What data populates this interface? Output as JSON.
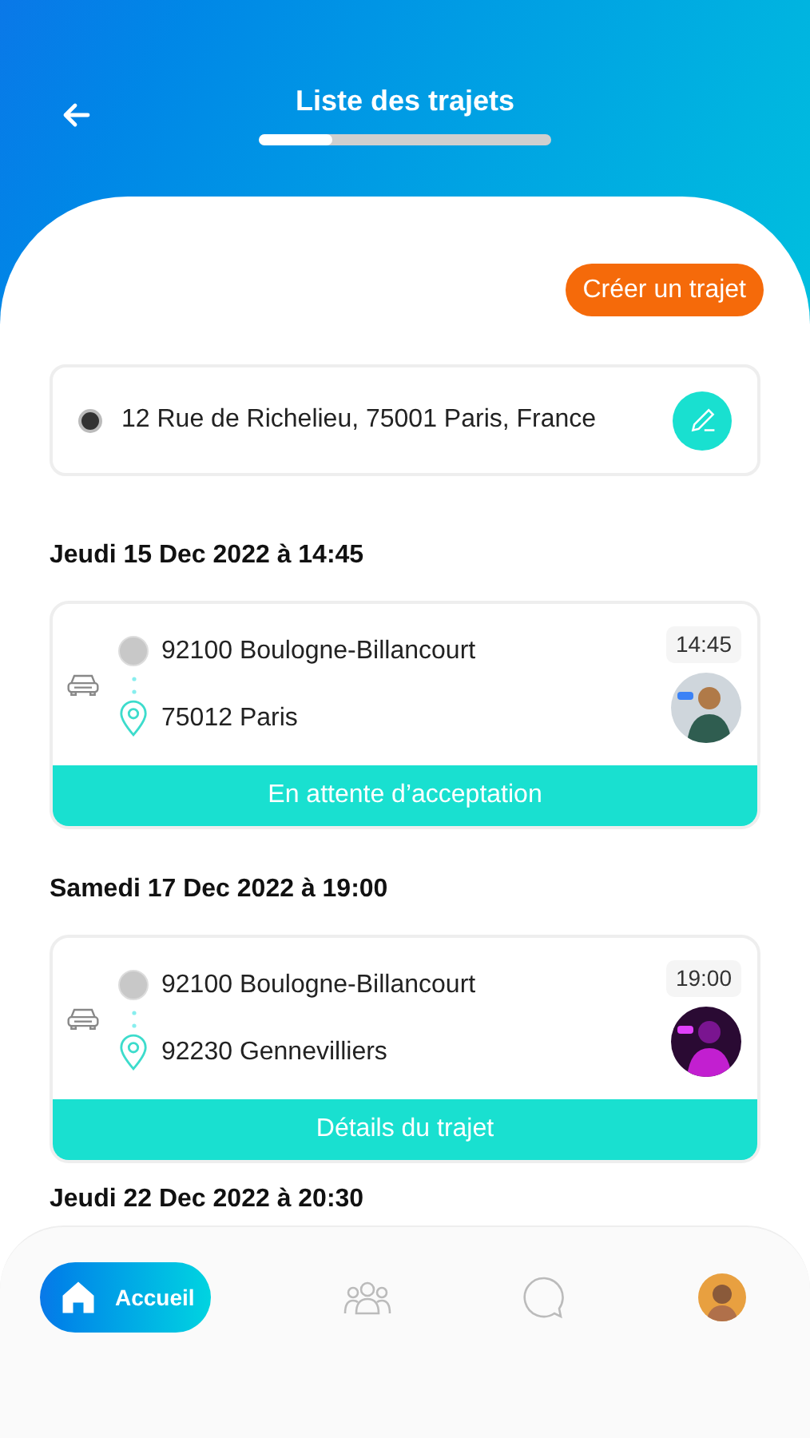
{
  "header": {
    "title": "Liste des trajets",
    "progress": {
      "level": 0.25
    }
  },
  "create_button": "Créer un trajet",
  "address": {
    "value": "12 Rue de Richelieu, 75001 Paris, France"
  },
  "trips": [
    {
      "date": "Jeudi 15 Dec 2022 à 14:45",
      "from": "92100 Boulogne-Billancourt",
      "to": "75012 Paris",
      "time": "14:45",
      "action": "En attente d’acceptation"
    },
    {
      "date": "Samedi 17 Dec 2022 à 19:00",
      "from": "92100 Boulogne-Billancourt",
      "to": "92230 Gennevilliers",
      "time": "19:00",
      "action": "Détails du trajet"
    }
  ],
  "next_date": "Jeudi 22 Dec 2022 à 20:30",
  "nav": [
    {
      "kind": "home",
      "label": "Accueil",
      "selected": true
    },
    {
      "kind": "group",
      "selected": false
    },
    {
      "kind": "chat",
      "selected": false
    },
    {
      "kind": "profile",
      "selected": false
    }
  ]
}
